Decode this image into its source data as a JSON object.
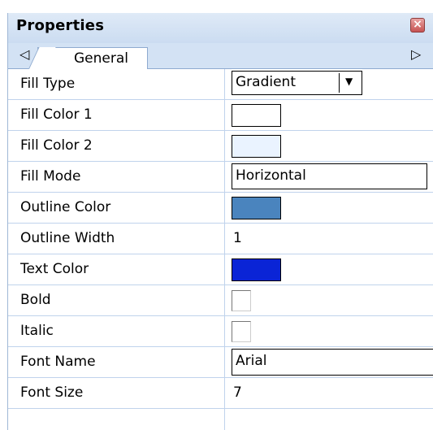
{
  "panel": {
    "title": "Properties",
    "close_icon": "close-icon",
    "tabs": {
      "left_arrow": "◁",
      "right_arrow": "▷",
      "active": "General"
    }
  },
  "rows": [
    {
      "label": "Fill Type",
      "value": "Gradient",
      "kind": "select"
    },
    {
      "label": "Fill Color 1",
      "kind": "color",
      "color": "#ffffff"
    },
    {
      "label": "Fill Color 2",
      "kind": "color",
      "color": "#eaf3ff"
    },
    {
      "label": "Fill Mode",
      "value": "Horizontal",
      "kind": "text"
    },
    {
      "label": "Outline Color",
      "kind": "color",
      "color": "#4a84be"
    },
    {
      "label": "Outline Width",
      "value": "1",
      "kind": "plain"
    },
    {
      "label": "Text Color",
      "kind": "color",
      "color": "#0a24d6"
    },
    {
      "label": "Bold",
      "kind": "checkbox",
      "checked": false
    },
    {
      "label": "Italic",
      "kind": "checkbox",
      "checked": false
    },
    {
      "label": "Font Name",
      "value": "Arial",
      "kind": "text"
    },
    {
      "label": "Font Size",
      "value": "7",
      "kind": "plain"
    }
  ],
  "colors": {
    "panel_bg": "#d3e2f4",
    "grid_line": "#c0d3ec"
  }
}
